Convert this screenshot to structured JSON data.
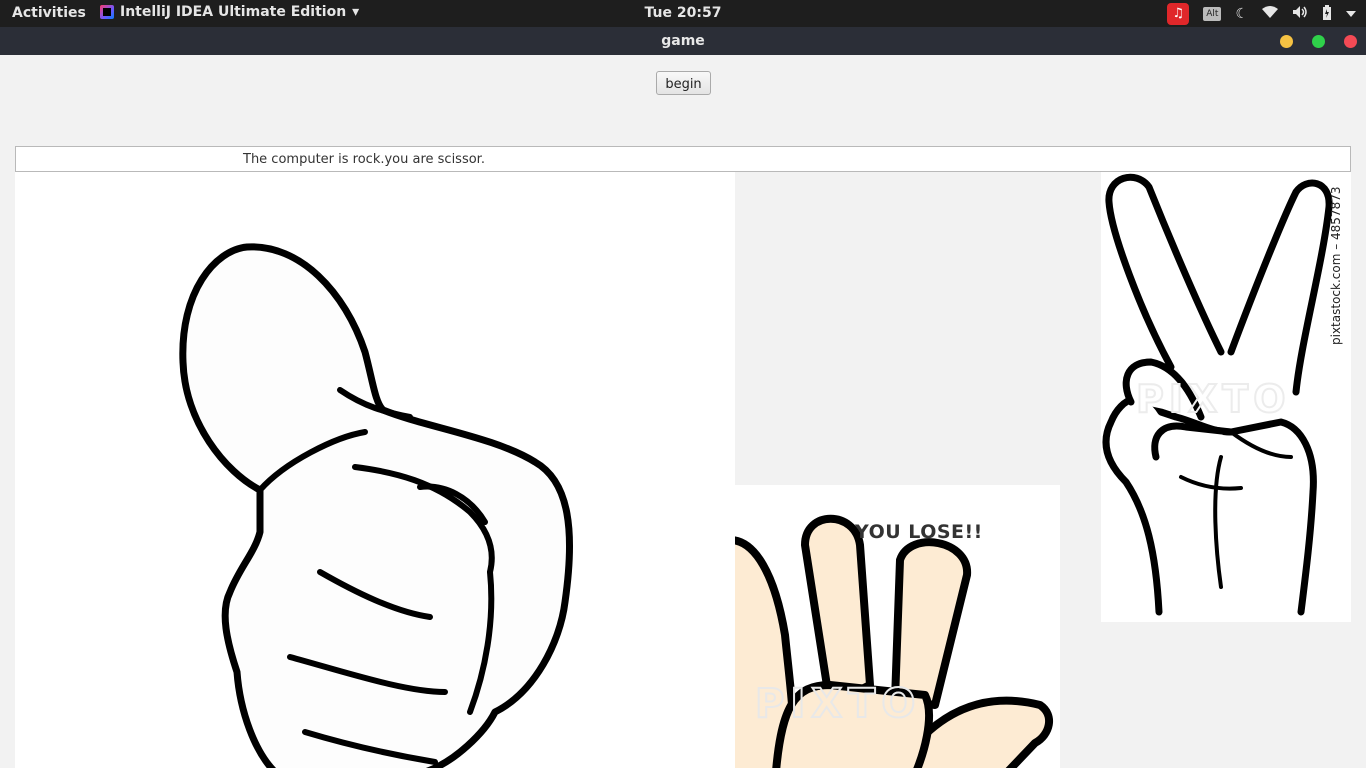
{
  "topbar": {
    "activities": "Activities",
    "app_name": "IntelliJ IDEA Ultimate Edition",
    "app_menu_arrow": "▾",
    "clock": "Tue 20:57",
    "tray": {
      "netease_icon": "netease-music-icon",
      "alt_label": "Alt",
      "icons": [
        "night-mode-icon",
        "wifi-icon",
        "volume-icon",
        "battery-icon",
        "system-menu-icon"
      ]
    }
  },
  "window": {
    "title": "game"
  },
  "content": {
    "begin_label": "begin",
    "status_text": "The computer is rock.you are scissor.",
    "result_text": "YOU LOSE!!",
    "watermark_text": "PIXTO",
    "stock_credit": "pixtastock.com – 4857873",
    "computer_choice": "rock",
    "player_choice": "scissor"
  }
}
